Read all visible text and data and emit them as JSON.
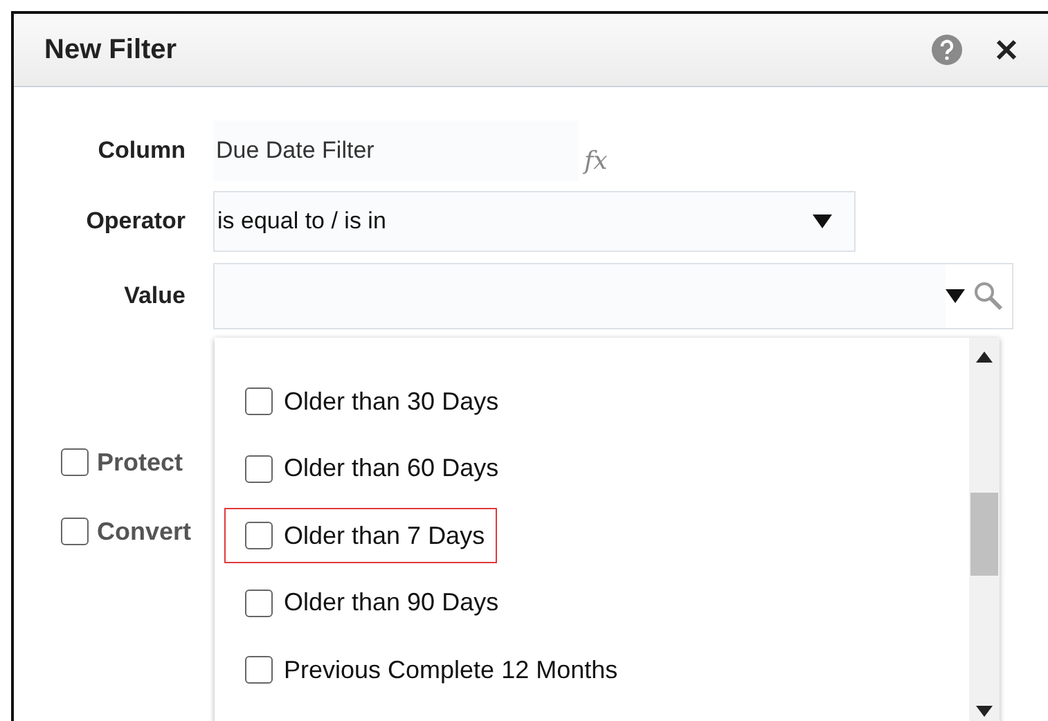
{
  "dialog": {
    "title": "New Filter"
  },
  "fields": [
    {
      "label": "Column",
      "kind": "text",
      "value": "Due Date Filter"
    },
    {
      "label": "Operator",
      "kind": "select",
      "value": "is equal to / is in"
    },
    {
      "label": "Value",
      "kind": "combo"
    }
  ],
  "formula_button": "fx",
  "options": [
    {
      "label": "Protect",
      "checked": false
    },
    {
      "label": "Convert",
      "checked": false
    }
  ],
  "dropdown": {
    "items": [
      {
        "label": "Older than 30 Days",
        "checked": false,
        "highlighted": false
      },
      {
        "label": "Older than 60 Days",
        "checked": false,
        "highlighted": false
      },
      {
        "label": "Older than 7 Days",
        "checked": false,
        "highlighted": true
      },
      {
        "label": "Older than 90 Days",
        "checked": false,
        "highlighted": false
      },
      {
        "label": "Previous Complete 12 Months",
        "checked": false,
        "highlighted": false
      }
    ]
  }
}
